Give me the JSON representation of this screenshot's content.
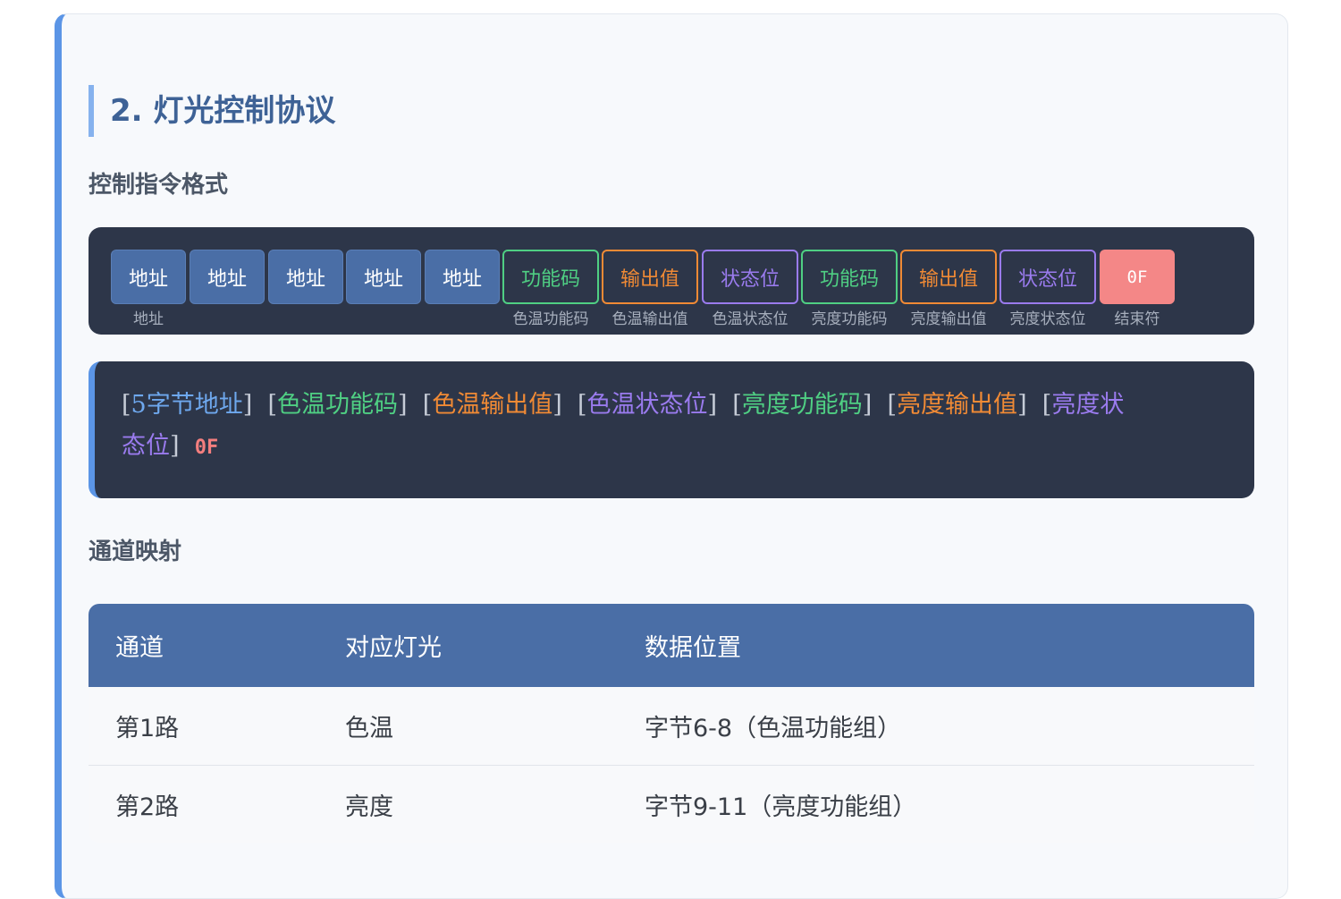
{
  "section_title": "2. 灯光控制协议",
  "command_format_heading": "控制指令格式",
  "bytes": [
    {
      "text": "地址",
      "label": "地址",
      "kind": "addr"
    },
    {
      "text": "地址",
      "label": "",
      "kind": "addr"
    },
    {
      "text": "地址",
      "label": "",
      "kind": "addr"
    },
    {
      "text": "地址",
      "label": "",
      "kind": "addr"
    },
    {
      "text": "地址",
      "label": "",
      "kind": "addr"
    },
    {
      "text": "功能码",
      "label": "色温功能码",
      "kind": "green"
    },
    {
      "text": "输出值",
      "label": "色温输出值",
      "kind": "orange"
    },
    {
      "text": "状态位",
      "label": "色温状态位",
      "kind": "purple"
    },
    {
      "text": "功能码",
      "label": "亮度功能码",
      "kind": "green"
    },
    {
      "text": "输出值",
      "label": "亮度输出值",
      "kind": "orange"
    },
    {
      "text": "状态位",
      "label": "亮度状态位",
      "kind": "purple"
    },
    {
      "text": "0F",
      "label": "结束符",
      "kind": "end"
    }
  ],
  "code_line": {
    "addr": "5字节地址",
    "ct_func": "色温功能码",
    "ct_out": "色温输出值",
    "ct_status": "色温状态位",
    "br_func": "亮度功能码",
    "br_out": "亮度输出值",
    "br_status_a": "亮度状",
    "br_status_b": "态位",
    "end": "0F"
  },
  "mapping_heading": "通道映射",
  "table": {
    "headers": [
      "通道",
      "对应灯光",
      "数据位置"
    ],
    "rows": [
      [
        "第1路",
        "色温",
        "字节6-8（色温功能组）"
      ],
      [
        "第2路",
        "亮度",
        "字节9-11（亮度功能组）"
      ]
    ]
  },
  "colors": {
    "accent": "#5b95e6",
    "dark_panel": "#2d3649",
    "address": "#4a6ea6",
    "function": "#4fcf83",
    "output": "#f08a35",
    "status": "#9a7bee",
    "end": "#f48787"
  }
}
